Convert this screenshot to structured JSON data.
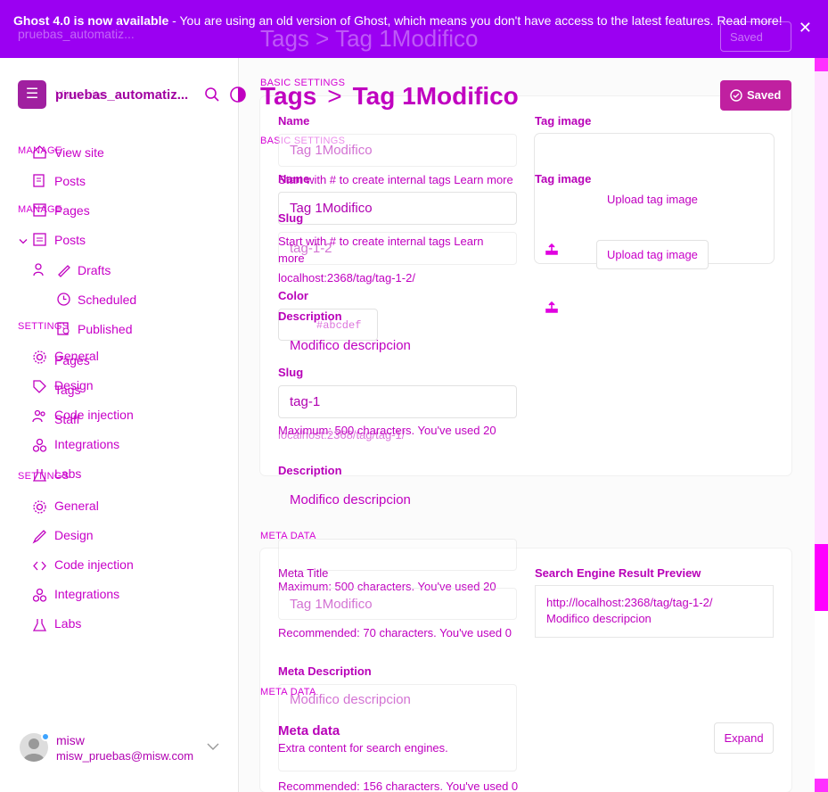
{
  "banner": {
    "bold": "Ghost 4.0 is now available",
    "text": " - You are using an old version of Ghost, which means you don't have access to the latest features. Read more!"
  },
  "ghost_overlay": {
    "site_top": "pruebas_automatiz...",
    "title": "Tags  >  Tag 1Modifico",
    "saved": "Saved"
  },
  "sidebar": {
    "site_name": "pruebas_automatiz...",
    "site_ghost": "View site",
    "manage_label": "MANAGE",
    "manage_label_ghost": "MANAGE",
    "settings_label": "SETTINGS",
    "settings_label_ghost": "SETTINGS",
    "items_ghost": [
      {
        "label": "View site"
      },
      {
        "label": "Posts"
      },
      {
        "label": "Pages"
      },
      {
        "label": "Posts"
      },
      {
        "label": "Drafts"
      },
      {
        "label": "Scheduled"
      },
      {
        "label": "Published"
      },
      {
        "label": "General"
      },
      {
        "label": "Design"
      },
      {
        "label": "Code injection"
      },
      {
        "label": "Integrations"
      },
      {
        "label": "Labs"
      }
    ],
    "items": [
      {
        "label": "Pages"
      },
      {
        "label": "Tags"
      },
      {
        "label": "Staff"
      },
      {
        "label": "Integrations"
      }
    ],
    "settings_items": [
      {
        "label": "General"
      },
      {
        "label": "Design"
      },
      {
        "label": "Code injection"
      },
      {
        "label": "Integrations"
      },
      {
        "label": "Labs"
      }
    ],
    "user": {
      "name": "misw",
      "email": "misw_pruebas@misw.com"
    }
  },
  "header": {
    "crumb_parent": "Tags",
    "crumb_sep": ">",
    "crumb_current": "Tag 1Modifico",
    "save_label": "Saved"
  },
  "basic": {
    "section_label": "BASIC SETTINGS",
    "section_label_ghost": "BASIC SETTINGS",
    "name_label": "Name",
    "name_label_ghost": "Name",
    "name_value": "Tag 1Modifico",
    "name_value_ghost": "Tag 1Modifico",
    "name_hint": "Start with # to create internal tags Learn more",
    "name_hint_ghost": "Start with # to create internal tags Learn more",
    "slug_label": "Slug",
    "slug_label_ghost": "Slug",
    "slug_value": "tag-1",
    "slug_value_ghost": "tag-1-2",
    "url": "localhost:2368/tag/tag-1-2/",
    "url_ghost": "localhost:2368/tag/tag-1/",
    "color_label": "Color",
    "color_value": "#abcdef",
    "description_label": "Description",
    "description_label_ghost": "Description",
    "description_value": "Modifico descripcion",
    "description_value_ghost": "Modifico descripcion",
    "desc_hint": "Maximum: 500 characters. You've used 20",
    "tag_image_label": "Tag image",
    "tag_image_label_ghost": "Tag image",
    "upload_label": "Upload tag image",
    "upload_label_ghost": "Upload tag image"
  },
  "meta": {
    "section_label": "META DATA",
    "section_label_ghost": "META DATA",
    "meta_title_label": "Meta Title",
    "meta_title_value": "Tag 1Modifico",
    "max_hint": "Maximum: 500 characters. You've used 20",
    "rec_hint": "Recommended: 70 characters. You've used 0",
    "meta_desc_label": "Meta Description",
    "meta_desc_value": "Modifico descripcion",
    "meta_desc_hint": "Recommended: 156 characters. You've used 0",
    "serp_label": "Search Engine Result Preview",
    "serp_url": "http://localhost:2368/tag/tag-1-2/",
    "serp_desc": "Modifico descripcion",
    "meta_card_title": "Meta data",
    "meta_card_sub": "Extra content for search engines.",
    "expand_label": "Expand"
  },
  "colors": {
    "banner": "#9b00f2",
    "accent": "#c020a0",
    "text": "#cc00cc"
  }
}
